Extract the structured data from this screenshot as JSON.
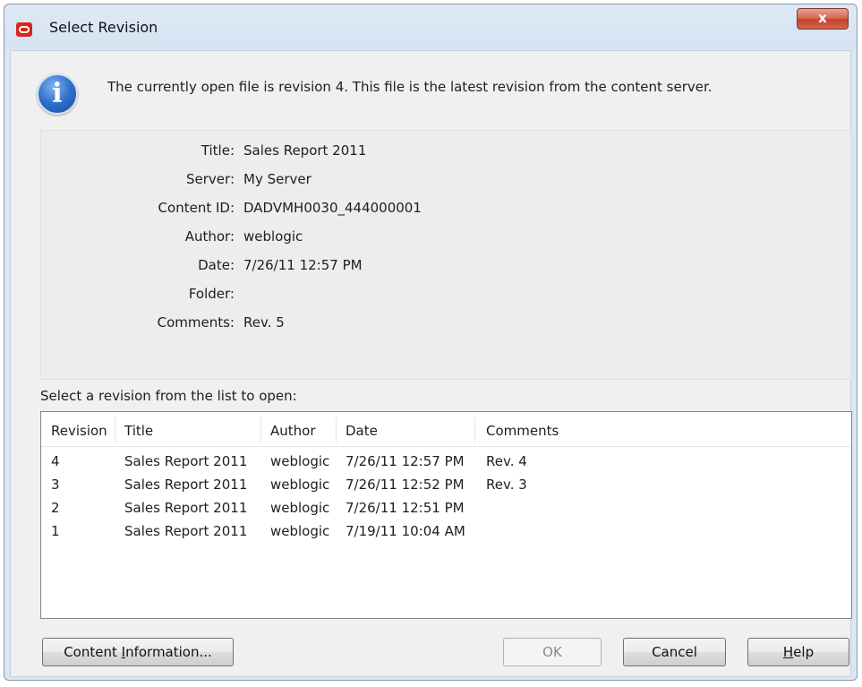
{
  "window": {
    "title": "Select Revision",
    "close_glyph": "x"
  },
  "message": "The currently open file is revision 4.  This file is the latest revision from the content server.",
  "details": [
    {
      "label": "Title:",
      "value": "Sales Report 2011"
    },
    {
      "label": "Server:",
      "value": "My Server"
    },
    {
      "label": "Content ID:",
      "value": "DADVMH0030_444000001"
    },
    {
      "label": "Author:",
      "value": "weblogic"
    },
    {
      "label": "Date:",
      "value": "7/26/11 12:57 PM"
    },
    {
      "label": "Folder:",
      "value": ""
    },
    {
      "label": "Comments:",
      "value": "Rev. 5"
    }
  ],
  "list_label": "Select a revision from the list to open:",
  "columns": [
    "Revision",
    "Title",
    "Author",
    "Date",
    "Comments"
  ],
  "rows": [
    [
      "4",
      "Sales Report 2011",
      "weblogic",
      "7/26/11 12:57 PM",
      "Rev. 4"
    ],
    [
      "3",
      "Sales Report 2011",
      "weblogic",
      "7/26/11 12:52 PM",
      "Rev. 3"
    ],
    [
      "2",
      "Sales Report 2011",
      "weblogic",
      "7/26/11 12:51 PM",
      ""
    ],
    [
      "1",
      "Sales Report 2011",
      "weblogic",
      "7/19/11 10:04 AM",
      ""
    ]
  ],
  "buttons": {
    "content_info": {
      "before": "Content ",
      "mnemonic": "I",
      "after": "nformation..."
    },
    "ok": "OK",
    "cancel": "Cancel",
    "help": {
      "before": "",
      "mnemonic": "H",
      "after": "elp"
    }
  },
  "icons": {
    "app": "oracle-icon",
    "info": "info-icon",
    "info_glyph": "i"
  },
  "colors": {
    "app_icon": "#d9261c",
    "close_button": "#c2432c",
    "info_icon": "#2f6fc9"
  }
}
